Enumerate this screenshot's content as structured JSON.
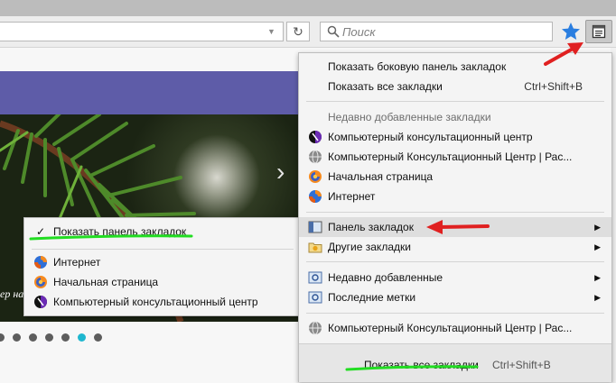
{
  "toolbar": {
    "search_placeholder": "Поиск",
    "reload_glyph": "↻",
    "url_dropdown_glyph": "▼"
  },
  "bookmarks_menu": {
    "show_sidebar": "Показать боковую панель закладок",
    "show_all": {
      "label": "Показать все закладки",
      "shortcut": "Ctrl+Shift+B"
    },
    "recent_header": "Недавно добавленные закладки",
    "recent_items": [
      {
        "label": "Компьютерный консультационный центр",
        "icon": "kcc-logo-icon"
      },
      {
        "label": "Компьютерный Консультационный Центр | Рас...",
        "icon": "globe-icon"
      },
      {
        "label": "Начальная страница",
        "icon": "firefox-icon"
      },
      {
        "label": "Интернет",
        "icon": "firefox-icon"
      }
    ],
    "folders": [
      {
        "label": "Панель закладок",
        "icon": "bookmarks-toolbar-icon"
      },
      {
        "label": "Другие закладки",
        "icon": "folder-icon"
      }
    ],
    "smart_folders": [
      {
        "label": "Недавно добавленные",
        "icon": "smart-folder-icon"
      },
      {
        "label": "Последние метки",
        "icon": "smart-folder-icon"
      }
    ],
    "bottom_item": {
      "label": "Компьютерный Консультационный Центр | Рас...",
      "icon": "globe-icon"
    },
    "footer": {
      "label": "Показать все закладки",
      "shortcut": "Ctrl+Shift+B"
    }
  },
  "toolbar_submenu": {
    "show_toolbar": {
      "label": "Показать панель закладок",
      "check": "✓"
    },
    "items": [
      {
        "label": "Интернет",
        "icon": "firefox-icon"
      },
      {
        "label": "Начальная страница",
        "icon": "firefox-icon"
      },
      {
        "label": "Компьютерный консультационный центр",
        "icon": "kcc-logo-icon"
      }
    ]
  },
  "page": {
    "slide_caption": "ер на",
    "slide_next": "›",
    "slide_dots": 7,
    "active_dot_index": 5,
    "active_dot_color": "#1fb7cf",
    "dot_color": "#5d5d5d",
    "banner_color": "#5e5ca8"
  },
  "colors": {
    "annotation_arrow": "#e02020",
    "annotation_underline": "#22dd22",
    "star": "#2a7ee0"
  }
}
